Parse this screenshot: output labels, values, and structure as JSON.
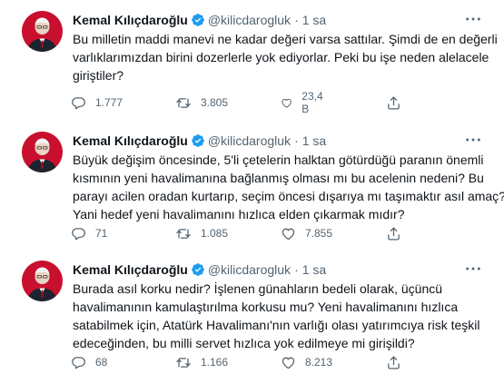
{
  "tweets": [
    {
      "name": "Kemal Kılıçdaroğlu",
      "handle": "@kilicdarogluk",
      "separator": "·",
      "time": "1 sa",
      "lines": [
        "Bu milletin maddi manevi ne kadar değeri varsa sattılar. Şimdi de en değerli",
        "varlıklarımızdan birini dozerlerle yok ediyorlar. Peki bu işe neden alelacele",
        "giriştiler?"
      ],
      "replies": "1.777",
      "retweets": "3.805",
      "likes": "23,4 B"
    },
    {
      "name": "Kemal Kılıçdaroğlu",
      "handle": "@kilicdarogluk",
      "separator": "·",
      "time": "1 sa",
      "lines": [
        "Büyük değişim öncesinde, 5'li çetelerin halktan götürdüğü paranın önemli",
        "kısmının yeni havalimanına bağlanmış olması mı bu acelenin nedeni? Bu",
        "parayı acilen oradan kurtarıp, seçim öncesi dışarıya mı taşımaktır asıl amaç?",
        "Yani hedef yeni havalimanını hızlıca elden çıkarmak mıdır?"
      ],
      "replies": "71",
      "retweets": "1.085",
      "likes": "7.855"
    },
    {
      "name": "Kemal Kılıçdaroğlu",
      "handle": "@kilicdarogluk",
      "separator": "·",
      "time": "1 sa",
      "lines": [
        "Burada asıl korku nedir? İşlenen günahların bedeli olarak, üçüncü",
        "havalimanının kamulaştırılma korkusu mu? Yeni havalimanını hızlıca",
        "satabilmek için, Atatürk Havalimanı'nın varlığı olası yatırımcıya risk teşkil",
        "edeceğinden, bu milli servet hızlıca yok edilmeye mi girişildi?"
      ],
      "replies": "68",
      "retweets": "1.166",
      "likes": "8.213"
    }
  ],
  "colors": {
    "verified": "#1d9bf0",
    "muted": "#536471",
    "text": "#0f1419",
    "avatar_bg": "#c8102e"
  },
  "icons": [
    "more-icon",
    "verified-icon",
    "reply-icon",
    "retweet-icon",
    "like-icon",
    "share-icon"
  ]
}
